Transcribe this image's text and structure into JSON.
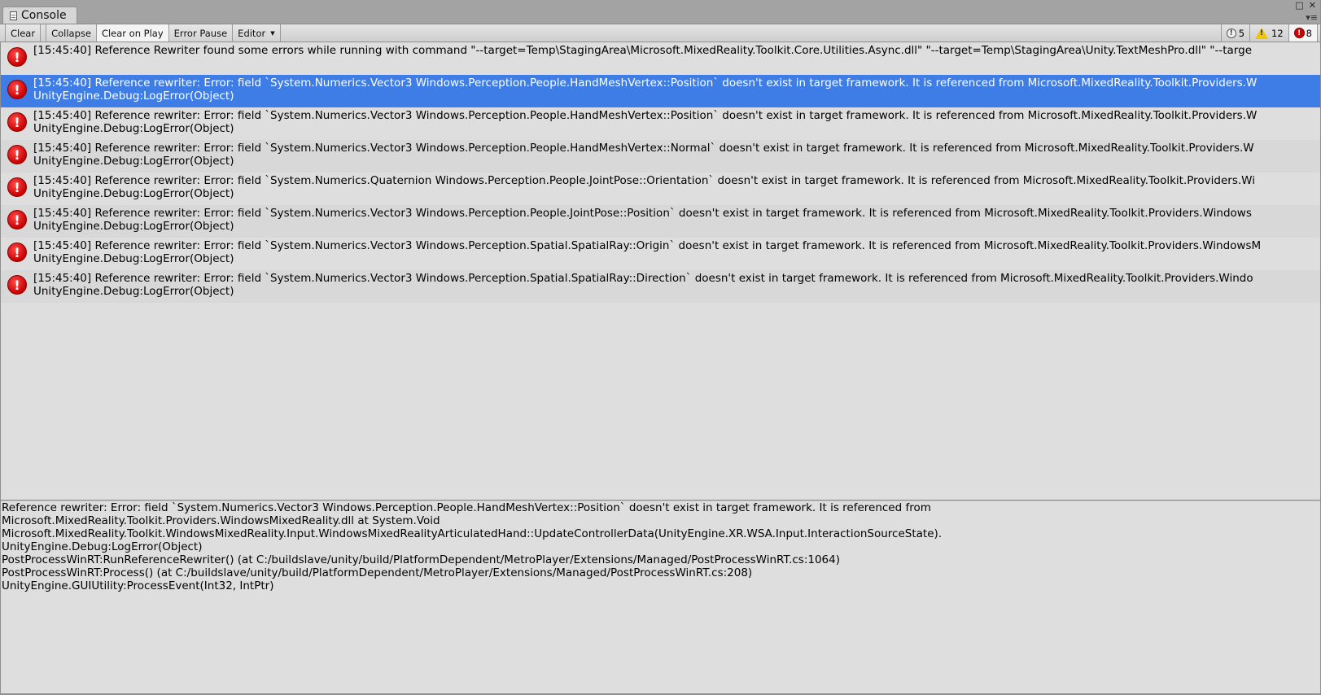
{
  "window": {
    "tab_label": "Console"
  },
  "toolbar": {
    "clear": "Clear",
    "collapse": "Collapse",
    "clear_on_play": "Clear on Play",
    "error_pause": "Error Pause",
    "editor": "Editor",
    "info_count": "5",
    "warning_count": "12",
    "error_count": "8"
  },
  "logs": [
    {
      "line1": "[15:45:40] Reference Rewriter found some errors while running with command \"--target=Temp\\StagingArea\\Microsoft.MixedReality.Toolkit.Core.Utilities.Async.dll\" \"--target=Temp\\StagingArea\\Unity.TextMeshPro.dll\" \"--targe",
      "line2": ""
    },
    {
      "line1": "[15:45:40] Reference rewriter: Error: field `System.Numerics.Vector3 Windows.Perception.People.HandMeshVertex::Position` doesn't exist in target framework. It is referenced from Microsoft.MixedReality.Toolkit.Providers.W",
      "line2": "UnityEngine.Debug:LogError(Object)"
    },
    {
      "line1": "[15:45:40] Reference rewriter: Error: field `System.Numerics.Vector3 Windows.Perception.People.HandMeshVertex::Position` doesn't exist in target framework. It is referenced from Microsoft.MixedReality.Toolkit.Providers.W",
      "line2": "UnityEngine.Debug:LogError(Object)"
    },
    {
      "line1": "[15:45:40] Reference rewriter: Error: field `System.Numerics.Vector3 Windows.Perception.People.HandMeshVertex::Normal` doesn't exist in target framework. It is referenced from Microsoft.MixedReality.Toolkit.Providers.W",
      "line2": "UnityEngine.Debug:LogError(Object)"
    },
    {
      "line1": "[15:45:40] Reference rewriter: Error: field `System.Numerics.Quaternion Windows.Perception.People.JointPose::Orientation` doesn't exist in target framework. It is referenced from Microsoft.MixedReality.Toolkit.Providers.Wi",
      "line2": "UnityEngine.Debug:LogError(Object)"
    },
    {
      "line1": "[15:45:40] Reference rewriter: Error: field `System.Numerics.Vector3 Windows.Perception.People.JointPose::Position` doesn't exist in target framework. It is referenced from Microsoft.MixedReality.Toolkit.Providers.Windows",
      "line2": "UnityEngine.Debug:LogError(Object)"
    },
    {
      "line1": "[15:45:40] Reference rewriter: Error: field `System.Numerics.Vector3 Windows.Perception.Spatial.SpatialRay::Origin` doesn't exist in target framework. It is referenced from Microsoft.MixedReality.Toolkit.Providers.WindowsM",
      "line2": "UnityEngine.Debug:LogError(Object)"
    },
    {
      "line1": "[15:45:40] Reference rewriter: Error: field `System.Numerics.Vector3 Windows.Perception.Spatial.SpatialRay::Direction` doesn't exist in target framework. It is referenced from Microsoft.MixedReality.Toolkit.Providers.Windo",
      "line2": "UnityEngine.Debug:LogError(Object)"
    }
  ],
  "detail": [
    "Reference rewriter: Error: field `System.Numerics.Vector3 Windows.Perception.People.HandMeshVertex::Position` doesn't exist in target framework. It is referenced from",
    "Microsoft.MixedReality.Toolkit.Providers.WindowsMixedReality.dll at System.Void",
    "Microsoft.MixedReality.Toolkit.WindowsMixedReality.Input.WindowsMixedRealityArticulatedHand::UpdateControllerData(UnityEngine.XR.WSA.Input.InteractionSourceState).",
    "UnityEngine.Debug:LogError(Object)",
    "PostProcessWinRT:RunReferenceRewriter() (at C:/buildslave/unity/build/PlatformDependent/MetroPlayer/Extensions/Managed/PostProcessWinRT.cs:1064)",
    "PostProcessWinRT:Process() (at C:/buildslave/unity/build/PlatformDependent/MetroPlayer/Extensions/Managed/PostProcessWinRT.cs:208)",
    "UnityEngine.GUIUtility:ProcessEvent(Int32, IntPtr)"
  ],
  "colors": {
    "selected_row": "#3e7de6",
    "error_icon": "#d40000",
    "warning_icon": "#f1c400"
  },
  "icons": {
    "tab": "document-icon",
    "info": "info-icon",
    "warning": "warning-icon",
    "error": "error-icon"
  }
}
